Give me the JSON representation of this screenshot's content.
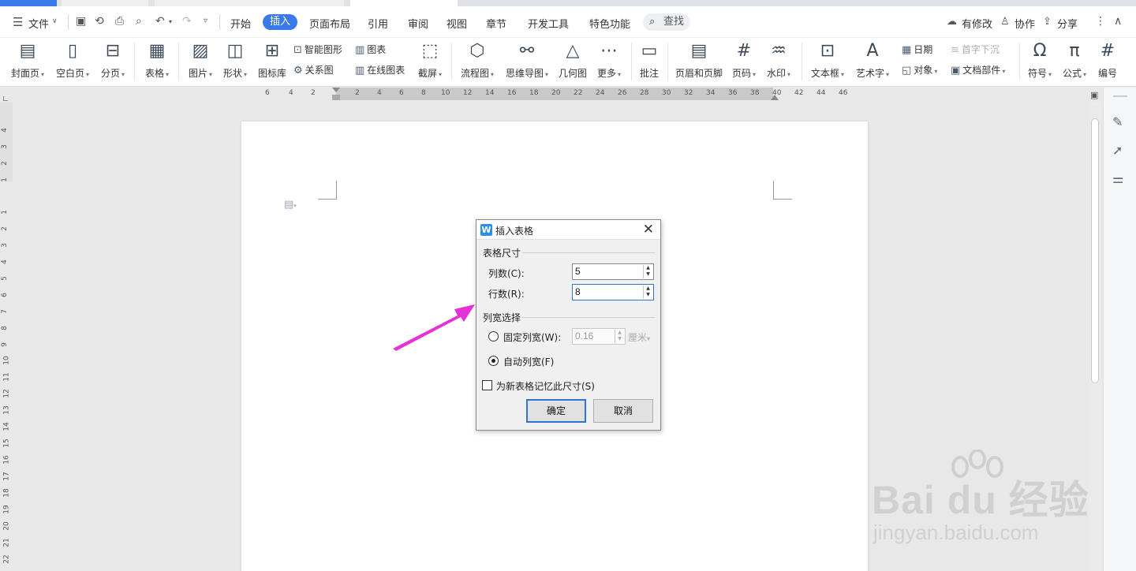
{
  "menubar": {
    "file_label": "文件",
    "tabs": [
      "开始",
      "插入",
      "页面布局",
      "引用",
      "审阅",
      "视图",
      "章节",
      "开发工具",
      "特色功能"
    ],
    "active_tab": "插入",
    "search_label": "查找",
    "right": {
      "modified": "有修改",
      "collab": "协作",
      "share": "分享"
    }
  },
  "ribbon": {
    "cover": "封面页",
    "blank": "空白页",
    "pagebreak": "分页",
    "table": "表格",
    "picture": "图片",
    "shape": "形状",
    "iconlib": "图标库",
    "smartart": "智能图形",
    "chart": "图表",
    "relation": "关系图",
    "onlinechart": "在线图表",
    "screenshot": "截屏",
    "flowchart": "流程图",
    "mindmap": "思维导图",
    "geometry": "几何图",
    "more": "更多",
    "comment": "批注",
    "headerfooter": "页眉和页脚",
    "pagenum": "页码",
    "watermark": "水印",
    "textbox": "文本框",
    "wordart": "艺术字",
    "date": "日期",
    "object": "对象",
    "dropcap": "首字下沉",
    "docparts": "文档部件",
    "symbol": "符号",
    "equation": "公式",
    "numbering": "编号"
  },
  "hruler_ticks": [
    "6",
    "4",
    "2",
    "2",
    "4",
    "6",
    "8",
    "10",
    "12",
    "14",
    "16",
    "18",
    "20",
    "22",
    "24",
    "26",
    "28",
    "30",
    "32",
    "34",
    "36",
    "38",
    "40",
    "42",
    "44",
    "46"
  ],
  "vruler_ticks": [
    "4",
    "3",
    "2",
    "1",
    "1",
    "2",
    "3",
    "4",
    "5",
    "6",
    "7",
    "8",
    "9",
    "10",
    "11",
    "12",
    "13",
    "14",
    "15",
    "16",
    "17",
    "18",
    "19",
    "20",
    "21",
    "22"
  ],
  "dialog": {
    "title": "插入表格",
    "section_size": "表格尺寸",
    "cols_label": "列数(C):",
    "cols_value": "5",
    "rows_label": "行数(R):",
    "rows_value": "8",
    "section_width": "列宽选择",
    "fixed_label": "固定列宽(W):",
    "fixed_value": "0.16",
    "fixed_unit": "厘米",
    "auto_label": "自动列宽(F)",
    "remember_label": "为新表格记忆此尺寸(S)",
    "ok": "确定",
    "cancel": "取消"
  },
  "watermark": {
    "brand": "Bai du 经验",
    "url": "jingyan.baidu.com"
  },
  "colors": {
    "accent": "#3a7ae8",
    "arrow": "#e630d8",
    "dialog_bg": "#f0f0f0"
  }
}
